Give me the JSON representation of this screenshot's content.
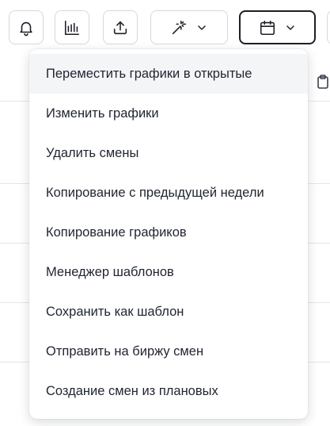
{
  "toolbar": {
    "buttons": [
      {
        "id": "bell",
        "icon": "bell-icon"
      },
      {
        "id": "report",
        "icon": "bar-chart-icon"
      },
      {
        "id": "upload",
        "icon": "upload-icon"
      },
      {
        "id": "magic",
        "icon": "magic-wand-icon",
        "dropdown": true
      },
      {
        "id": "calendar",
        "icon": "calendar-icon",
        "dropdown": true,
        "active": true
      }
    ]
  },
  "menu": {
    "items": [
      {
        "label": "Переместить графики в открытые",
        "highlighted": true
      },
      {
        "label": "Изменить графики"
      },
      {
        "label": "Удалить смены"
      },
      {
        "label": "Копирование с предыдущей недели"
      },
      {
        "label": "Копирование графиков"
      },
      {
        "label": "Менеджер шаблонов"
      },
      {
        "label": "Сохранить как шаблон"
      },
      {
        "label": "Отправить на биржу смен"
      },
      {
        "label": "Создание смен из плановых"
      }
    ]
  },
  "colors": {
    "text": "#1f2430",
    "border": "#d5d8de",
    "active_border": "#1c1f26",
    "hover_bg": "#f4f5f7"
  }
}
